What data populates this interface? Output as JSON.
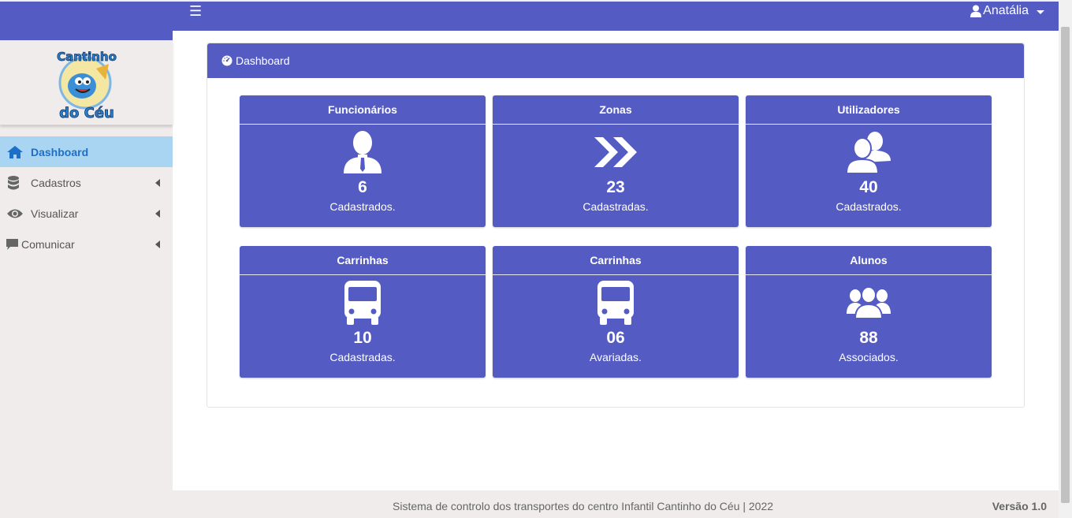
{
  "topbar": {
    "menu_icon": "hamburger-icon",
    "user_name": "Anatália",
    "user_icon": "user-icon"
  },
  "sidebar": {
    "logo_text": [
      "Cantinho",
      "do Céu"
    ],
    "items": [
      {
        "label": "Dashboard",
        "icon": "home-icon",
        "active": true
      },
      {
        "label": "Cadastros",
        "icon": "database-icon"
      },
      {
        "label": "Visualizar",
        "icon": "eye-icon"
      },
      {
        "label": "Comunicar",
        "icon": "comment-icon"
      }
    ]
  },
  "panel": {
    "title": "Dashboard",
    "icon": "tachometer-icon"
  },
  "cards": [
    {
      "title": "Funcionários",
      "value": "6",
      "label": "Cadastrados.",
      "icon": "user-tie-icon"
    },
    {
      "title": "Zonas",
      "value": "23",
      "label": "Cadastradas.",
      "icon": "double-chevron-icon"
    },
    {
      "title": "Utilizadores",
      "value": "40",
      "label": "Cadastrados.",
      "icon": "users-icon"
    },
    {
      "title": "Carrinhas",
      "value": "10",
      "label": "Cadastradas.",
      "icon": "bus-icon"
    },
    {
      "title": "Carrinhas",
      "value": "06",
      "label": "Avariadas.",
      "icon": "bus-icon"
    },
    {
      "title": "Alunos",
      "value": "88",
      "label": "Associados.",
      "icon": "group-icon"
    }
  ],
  "footer": {
    "text": "Sistema de controlo dos transportes do centro Infantil Cantinho do Céu | 2022",
    "version": "Versão 1.0"
  },
  "colors": {
    "primary": "#545cc4",
    "active_bg": "#a9d5f2",
    "active_text": "#1d6fc8",
    "sidebar_bg": "#f0ecec"
  }
}
